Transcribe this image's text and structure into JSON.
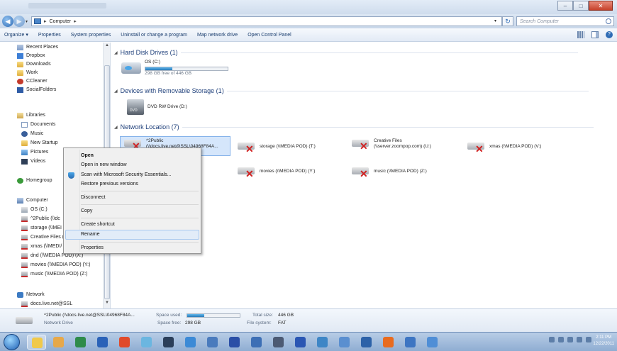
{
  "window": {
    "controls": {
      "minimize": "–",
      "maximize": "□",
      "close": "✕"
    }
  },
  "address": {
    "crumb_root_arrow": "▸",
    "crumb": "Computer",
    "crumb_arrow": "▸",
    "search_placeholder": "Search Computer"
  },
  "commandbar": {
    "items": [
      "Organize ▾",
      "Properties",
      "System properties",
      "Uninstall or change a program",
      "Map network drive",
      "Open Control Panel"
    ]
  },
  "navpane": {
    "favorites": [
      {
        "label": "Recent Places",
        "icon": "recent"
      },
      {
        "label": "Dropbox",
        "icon": "dropbox"
      },
      {
        "label": "Downloads",
        "icon": "folder"
      },
      {
        "label": "Work",
        "icon": "folder"
      },
      {
        "label": "CCleaner",
        "icon": "ccleaner"
      },
      {
        "label": "SocialFolders",
        "icon": "social"
      }
    ],
    "libraries": {
      "label": "Libraries"
    },
    "library_items": [
      {
        "label": "Documents",
        "icon": "doc"
      },
      {
        "label": "Music",
        "icon": "music"
      },
      {
        "label": "New Startup",
        "icon": "folder"
      },
      {
        "label": "Pictures",
        "icon": "pics"
      },
      {
        "label": "Videos",
        "icon": "video"
      }
    ],
    "homegroup": {
      "label": "Homegroup"
    },
    "computer": {
      "label": "Computer"
    },
    "computer_items": [
      {
        "label": "OS (C:)",
        "icon": "drive"
      },
      {
        "label": "^2Public (\\\\dc",
        "icon": "netdrive"
      },
      {
        "label": "storage (\\\\MEI",
        "icon": "netdrive"
      },
      {
        "label": "Creative Files (",
        "icon": "netdrive"
      },
      {
        "label": "xmas (\\\\MEDI/",
        "icon": "netdrive"
      },
      {
        "label": "dnd (\\\\MEDIA POD) (X:)",
        "icon": "netdrive"
      },
      {
        "label": "movies (\\\\MEDIA POD) (Y:)",
        "icon": "netdrive"
      },
      {
        "label": "music (\\\\MEDIA POD) (Z:)",
        "icon": "netdrive"
      }
    ],
    "network": {
      "label": "Network"
    },
    "network_items": [
      {
        "label": "docs.live.net@SSL",
        "icon": "netdrive"
      }
    ]
  },
  "content": {
    "groups": [
      {
        "title": "Hard Disk Drives (1)"
      },
      {
        "title": "Devices with Removable Storage (1)"
      },
      {
        "title": "Network Location (7)"
      }
    ],
    "hdd": {
      "name": "OS (C:)",
      "free": "298 GB free of 446 GB",
      "used_fraction": 0.33
    },
    "dvd": {
      "name": "DVD RW Drive (D:)"
    },
    "network_locations": [
      {
        "line1": "^2Public",
        "line2": "(\\\\docs.live.net@SSL\\04968F84A..."
      },
      {
        "line1": "storage (\\\\MEDIA POD) (T:)",
        "line2": ""
      },
      {
        "line1": "Creative Files",
        "line2": "(\\\\server.zoompop.com) (U:)"
      },
      {
        "line1": "xmas (\\\\MEDIA POD) (V:)",
        "line2": ""
      },
      {
        "line1": "movies (\\\\MEDIA POD) (Y:)",
        "line2": ""
      },
      {
        "line1": "music (\\\\MEDIA POD) (Z:)",
        "line2": ""
      }
    ]
  },
  "context_menu": {
    "items": [
      {
        "label": "Open",
        "bold": true
      },
      {
        "label": "Open in new window"
      },
      {
        "label": "Scan with Microsoft Security Essentials..."
      },
      {
        "label": "Restore previous versions"
      },
      {
        "label": "Disconnect"
      },
      {
        "label": "Copy"
      },
      {
        "label": "Create shortcut"
      },
      {
        "label": "Rename",
        "highlighted": true
      },
      {
        "label": "Properties"
      }
    ]
  },
  "details": {
    "name": "^2Public (\\\\docs.live.net@SSL\\04968F84A...",
    "type": "Network Drive",
    "space_used_label": "Space used:",
    "space_used_fraction": 0.33,
    "space_free_label": "Space free:",
    "space_free_value": "298 GB",
    "total_size_label": "Total size:",
    "total_size_value": "446 GB",
    "filesystem_label": "File system:",
    "filesystem_value": "FAT"
  },
  "taskbar": {
    "apps": [
      {
        "name": "explorer-app",
        "color": "#f0c94a"
      },
      {
        "name": "app-2",
        "color": "#e6a84a"
      },
      {
        "name": "app-3",
        "color": "#2e8b4a"
      },
      {
        "name": "app-4",
        "color": "#2a62b8"
      },
      {
        "name": "chrome-app",
        "color": "#e04a2a"
      },
      {
        "name": "app-6",
        "color": "#6bb6e0"
      },
      {
        "name": "steam-app",
        "color": "#2b3f5a"
      },
      {
        "name": "ie-app",
        "color": "#3c8ad6"
      },
      {
        "name": "app-9",
        "color": "#4a7bbd"
      },
      {
        "name": "app-10",
        "color": "#2a4fa6"
      },
      {
        "name": "app-11",
        "color": "#3d6fb5"
      },
      {
        "name": "app-12",
        "color": "#4c5a73"
      },
      {
        "name": "app-13",
        "color": "#2a56b3"
      },
      {
        "name": "app-14",
        "color": "#3e86c6"
      },
      {
        "name": "app-15",
        "color": "#5a8fd0"
      },
      {
        "name": "app-16",
        "color": "#2d62a8"
      },
      {
        "name": "firefox-app",
        "color": "#e86b1f"
      },
      {
        "name": "app-18",
        "color": "#3d75c2"
      },
      {
        "name": "app-19",
        "color": "#4f8ed6"
      }
    ],
    "clock_time": "2:11 PM",
    "clock_date": "12/22/2011"
  }
}
